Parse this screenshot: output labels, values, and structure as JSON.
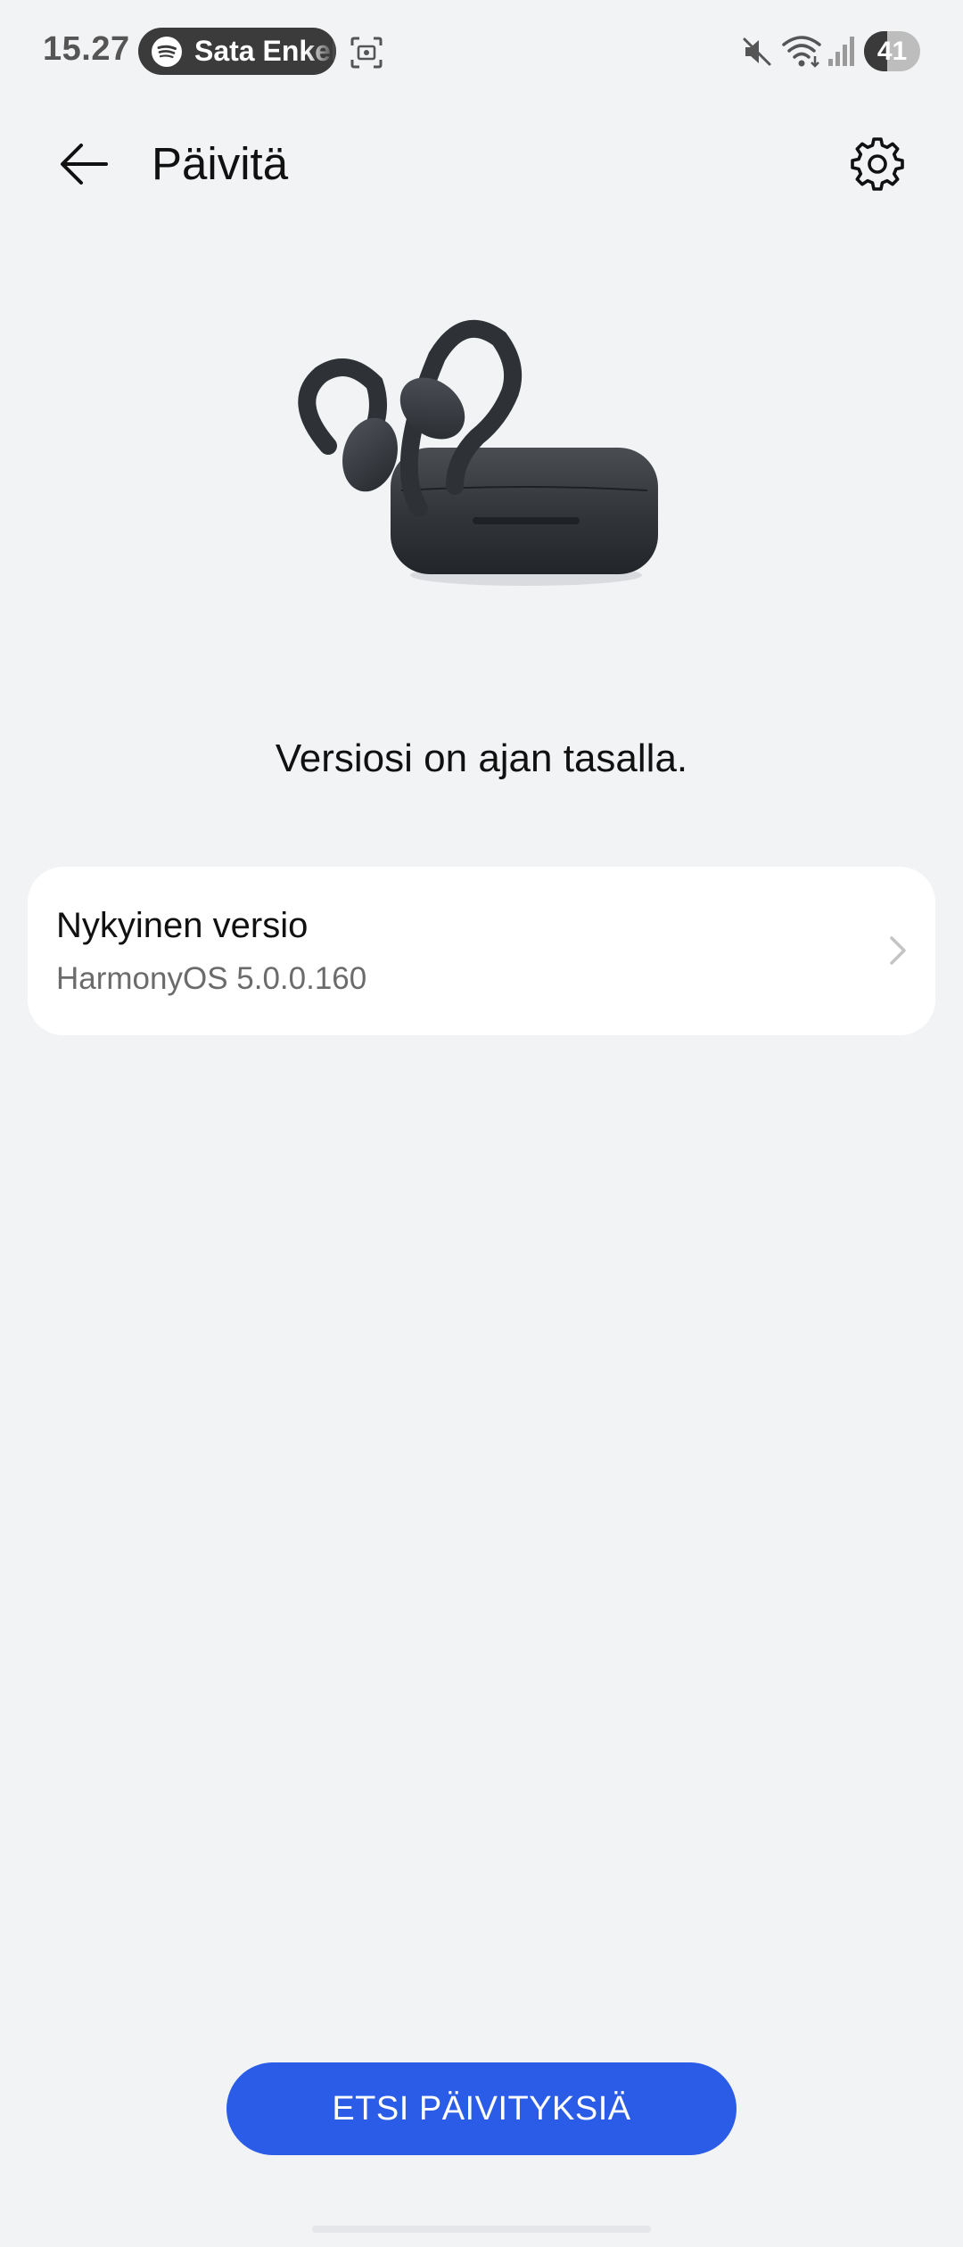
{
  "status_bar": {
    "time": "15.27",
    "media_chip_text": "Sata Enkeliä",
    "battery_level": "41",
    "battery_fraction": 0.41,
    "icons": [
      "spotify-icon",
      "screen-capture-icon",
      "mute-icon",
      "wifi-icon",
      "signal-icon",
      "battery-icon"
    ]
  },
  "app_bar": {
    "title": "Päivitä",
    "back_icon": "arrow-left-icon",
    "settings_icon": "gear-icon"
  },
  "main": {
    "status_message": "Versiosi on ajan tasalla.",
    "version_card": {
      "label": "Nykyinen versio",
      "value": "HarmonyOS 5.0.0.160",
      "chevron_icon": "chevron-right-icon"
    }
  },
  "footer": {
    "search_updates_label": "ETSI PÄIVITYKSIÄ"
  },
  "colors": {
    "background": "#f1f3f5",
    "card": "#ffffff",
    "accent": "#2b5ce8",
    "secondary_text": "#6b6b6b"
  }
}
